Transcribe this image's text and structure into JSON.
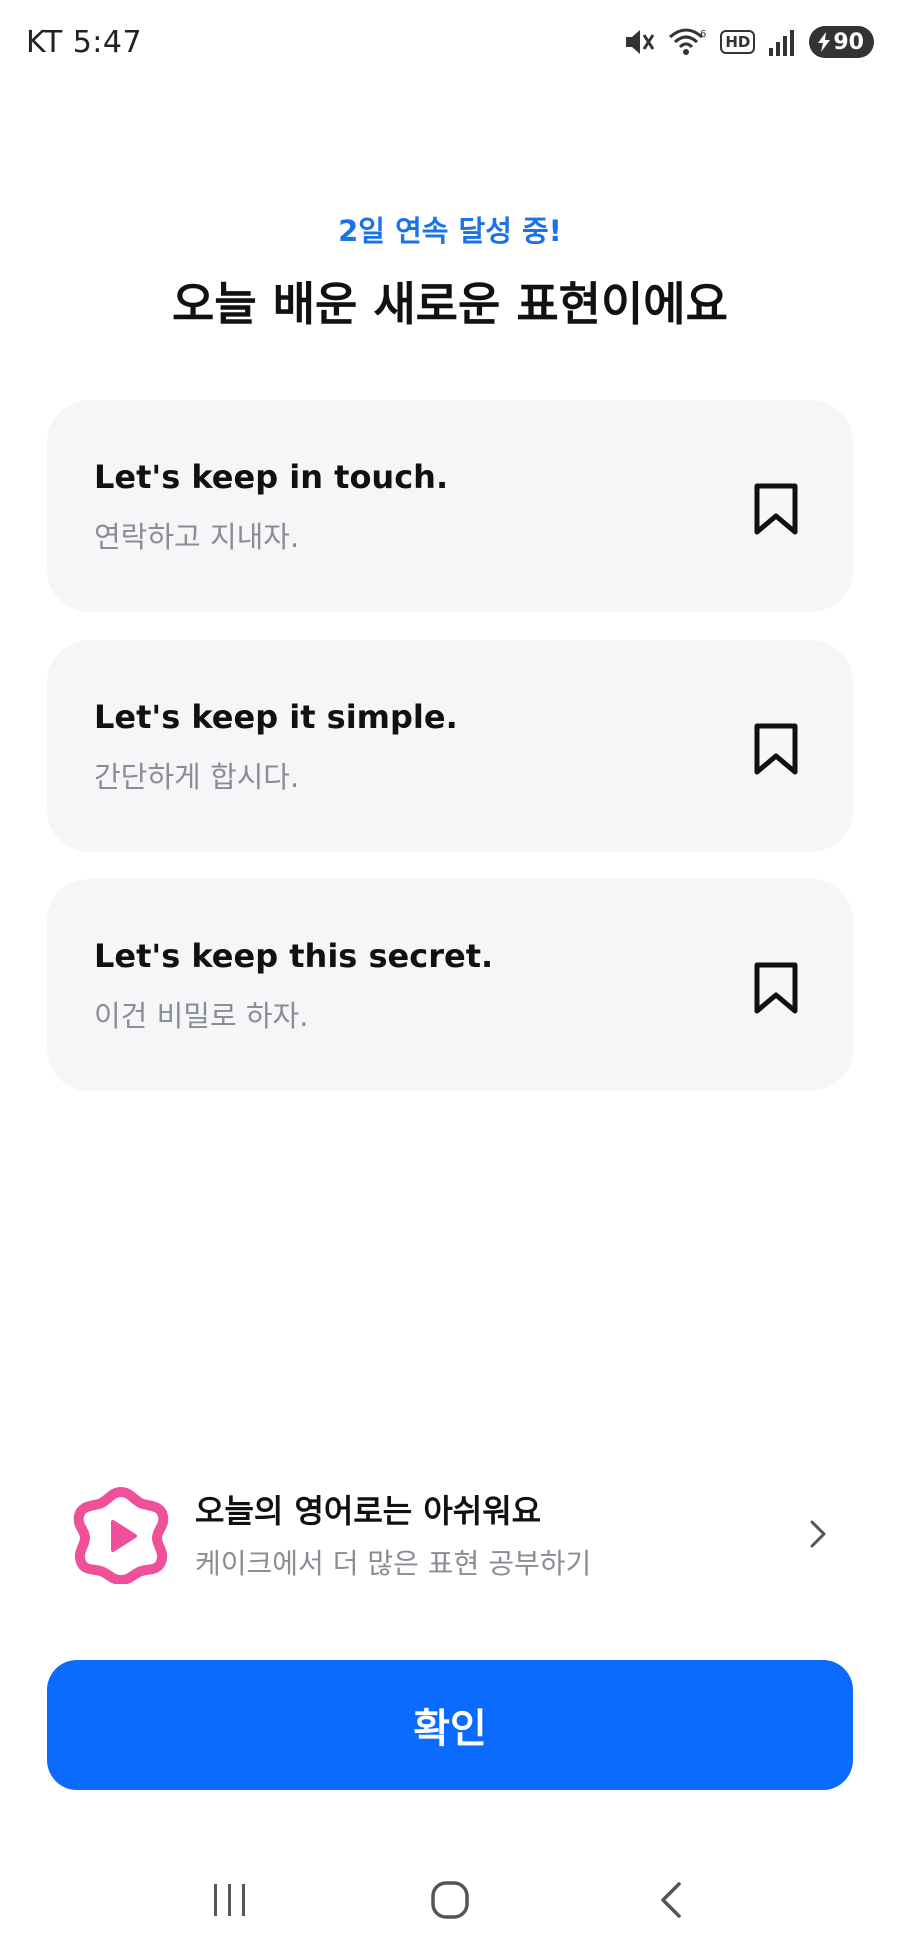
{
  "status_bar": {
    "carrier_time": "KT 5:47",
    "network_badge": "HD",
    "battery_level": "90"
  },
  "header": {
    "streak": "2일 연속 달성 중!",
    "title": "오늘 배운 새로운 표현이에요"
  },
  "phrases": [
    {
      "en": "Let's keep in touch.",
      "ko": "연락하고 지내자."
    },
    {
      "en": "Let's keep it simple.",
      "ko": "간단하게 합시다."
    },
    {
      "en": "Let's keep this secret.",
      "ko": "이건 비밀로 하자."
    }
  ],
  "promo": {
    "title": "오늘의 영어로는 아쉬워요",
    "subtitle": "케이크에서 더 많은 표현 공부하기",
    "logo_color": "#f0509a"
  },
  "confirm_label": "확인",
  "colors": {
    "accent": "#0b6bff",
    "streak": "#1a73e8",
    "card_bg": "#f5f6f8"
  }
}
